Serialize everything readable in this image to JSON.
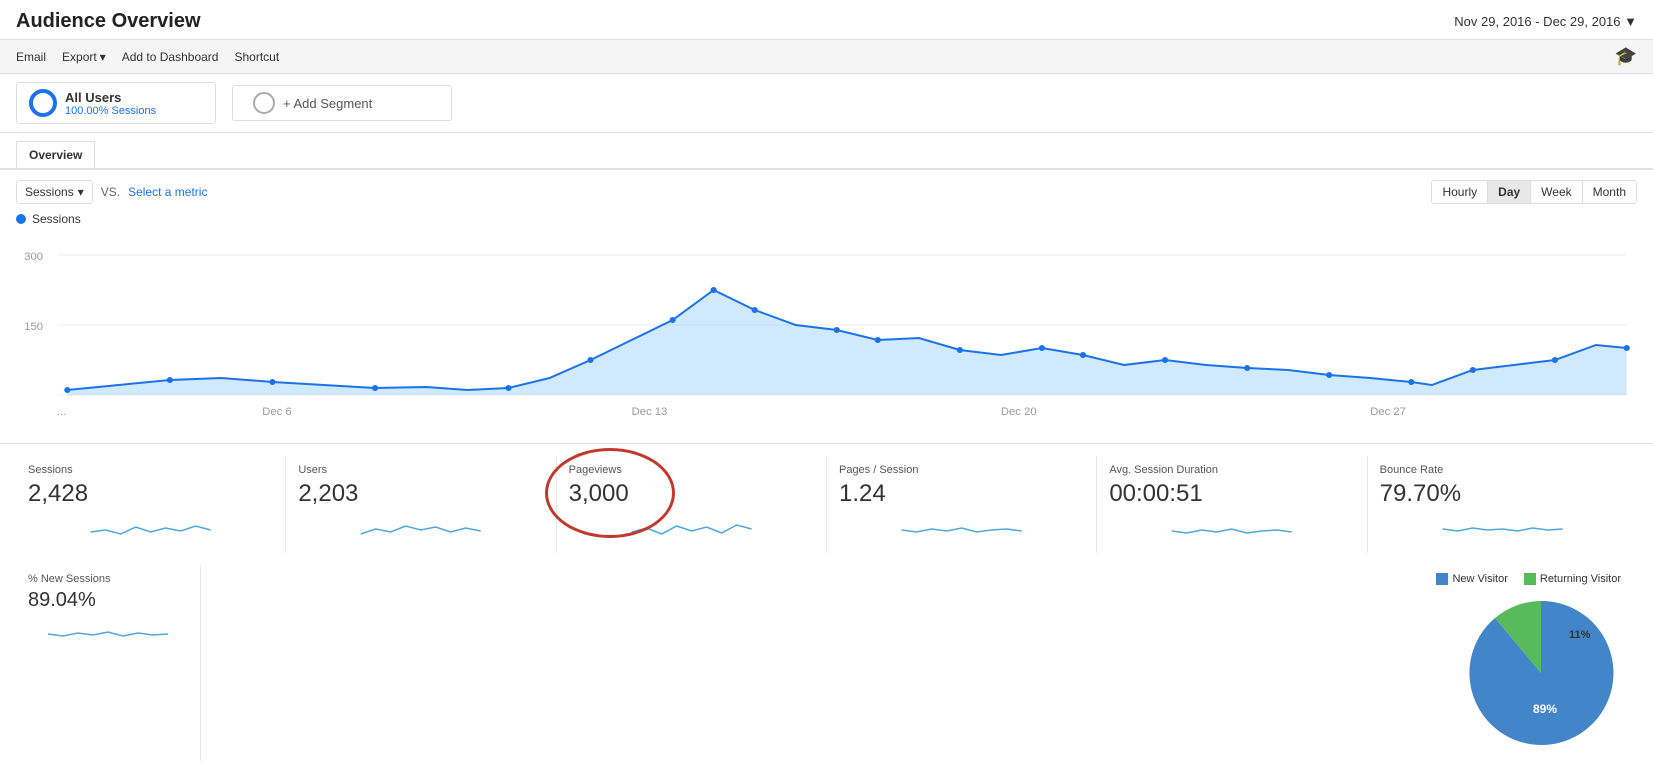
{
  "header": {
    "title": "Audience Overview",
    "date_range": "Nov 29, 2016 - Dec 29, 2016 ▼"
  },
  "toolbar": {
    "email": "Email",
    "export": "Export",
    "export_arrow": "▾",
    "add_dashboard": "Add to Dashboard",
    "shortcut": "Shortcut"
  },
  "segment": {
    "all_users": "All Users",
    "sessions_pct": "100.00% Sessions",
    "add_segment": "+ Add Segment"
  },
  "tabs": {
    "overview": "Overview"
  },
  "chart": {
    "metric_label": "Sessions",
    "vs_text": "VS.",
    "select_metric": "Select a metric",
    "sessions_legend": "Sessions",
    "y_labels": [
      "300",
      "150"
    ],
    "x_labels": [
      "...",
      "Dec 6",
      "Dec 13",
      "Dec 20",
      "Dec 27"
    ],
    "time_buttons": [
      "Hourly",
      "Day",
      "Week",
      "Month"
    ],
    "active_time": "Day"
  },
  "stats": [
    {
      "label": "Sessions",
      "value": "2,428"
    },
    {
      "label": "Users",
      "value": "2,203"
    },
    {
      "label": "Pageviews",
      "value": "3,000",
      "highlighted": true
    },
    {
      "label": "Pages / Session",
      "value": "1.24"
    },
    {
      "label": "Avg. Session Duration",
      "value": "00:00:51"
    },
    {
      "label": "Bounce Rate",
      "value": "79.70%"
    }
  ],
  "bottom_stats": [
    {
      "label": "% New Sessions",
      "value": "89.04%"
    }
  ],
  "pie": {
    "new_visitor_label": "New Visitor",
    "returning_visitor_label": "Returning Visitor",
    "new_visitor_color": "#4285c8",
    "returning_visitor_color": "#57bb5b",
    "new_pct": 89,
    "returning_pct": 11,
    "label_89": "89%",
    "label_11": "11%"
  }
}
